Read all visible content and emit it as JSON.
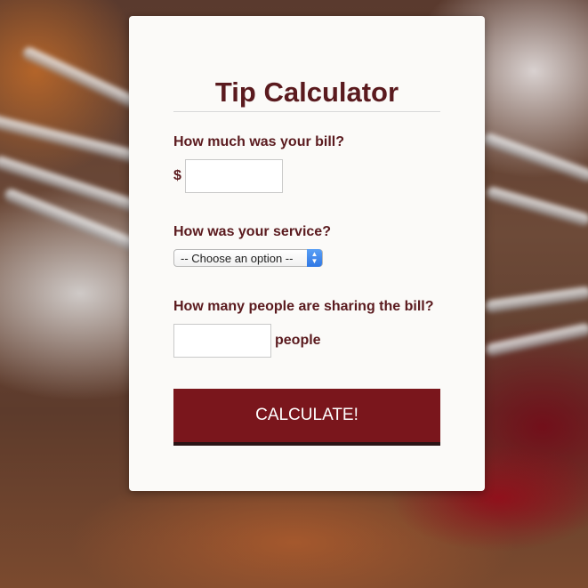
{
  "calculator": {
    "title": "Tip Calculator",
    "bill_question": "How much was your bill?",
    "currency_symbol": "$",
    "bill_value": "",
    "service_question": "How was your service?",
    "service_selected": "-- Choose an option --",
    "people_question": "How many people are sharing the bill?",
    "people_value": "",
    "people_suffix": "people",
    "calculate_label": "CALCULATE!"
  },
  "colors": {
    "title_text": "#5a1a1e",
    "button_bg": "#7a161c",
    "button_border": "#2b1416",
    "card_bg": "#fbfaf8"
  }
}
